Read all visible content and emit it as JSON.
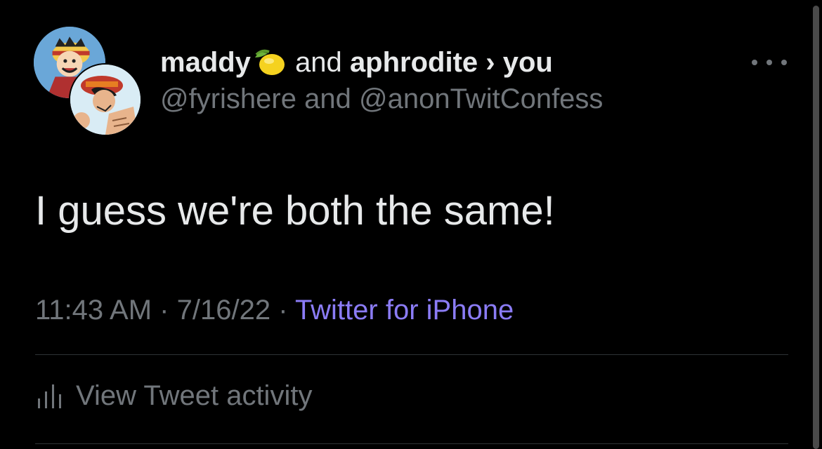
{
  "tweet": {
    "author_1": "maddy",
    "author_1_emoji": "lemon-icon",
    "connector": "and",
    "author_2": "aphrodite",
    "reply_arrow": "›",
    "recipient": "you",
    "handle_1": "@fyrishere",
    "handle_connector": "and",
    "handle_2": "@anonTwitConfess",
    "text": "I guess we're both the same!",
    "time": "11:43 AM",
    "date": "7/16/22",
    "separator": "·",
    "source": "Twitter for iPhone",
    "activity_label": "View Tweet activity"
  },
  "colors": {
    "background": "#000000",
    "primary_text": "#e7e9ea",
    "secondary_text": "#71767b",
    "link": "#8b7cf6",
    "divider": "#2f3336"
  },
  "icons": {
    "more": "more-horizontal-icon",
    "activity": "bar-chart-icon"
  }
}
